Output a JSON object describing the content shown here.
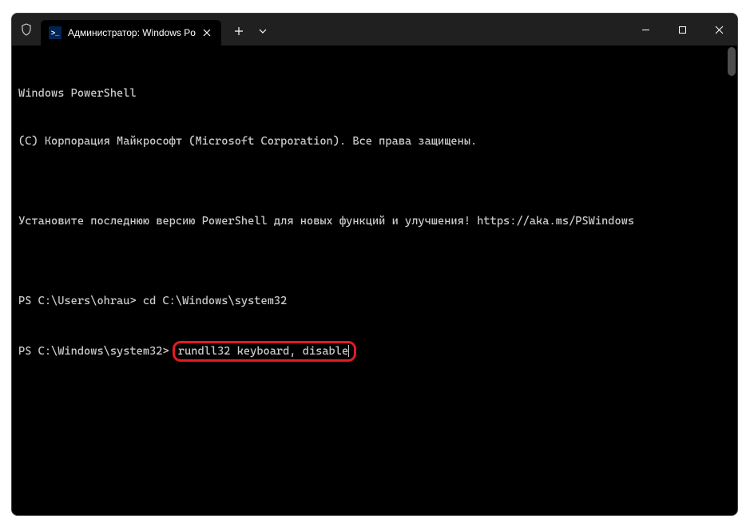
{
  "titlebar": {
    "tab_title": "Администратор: Windows Po",
    "tab_icon_text": ">_"
  },
  "terminal": {
    "line1": "Windows PowerShell",
    "line2": "(C) Корпорация Майкрософт (Microsoft Corporation). Все права защищены.",
    "line3": "",
    "line4": "Установите последнюю версию PowerShell для новых функций и улучшения! https://aka.ms/PSWindows",
    "line5": "",
    "prompt1_prefix": "PS C:\\Users\\ohrau> ",
    "prompt1_cmd": "cd C:\\Windows\\system32",
    "prompt2_prefix": "PS C:\\Windows\\system32> ",
    "prompt2_cmd": "rundll32 keyboard, disable"
  }
}
